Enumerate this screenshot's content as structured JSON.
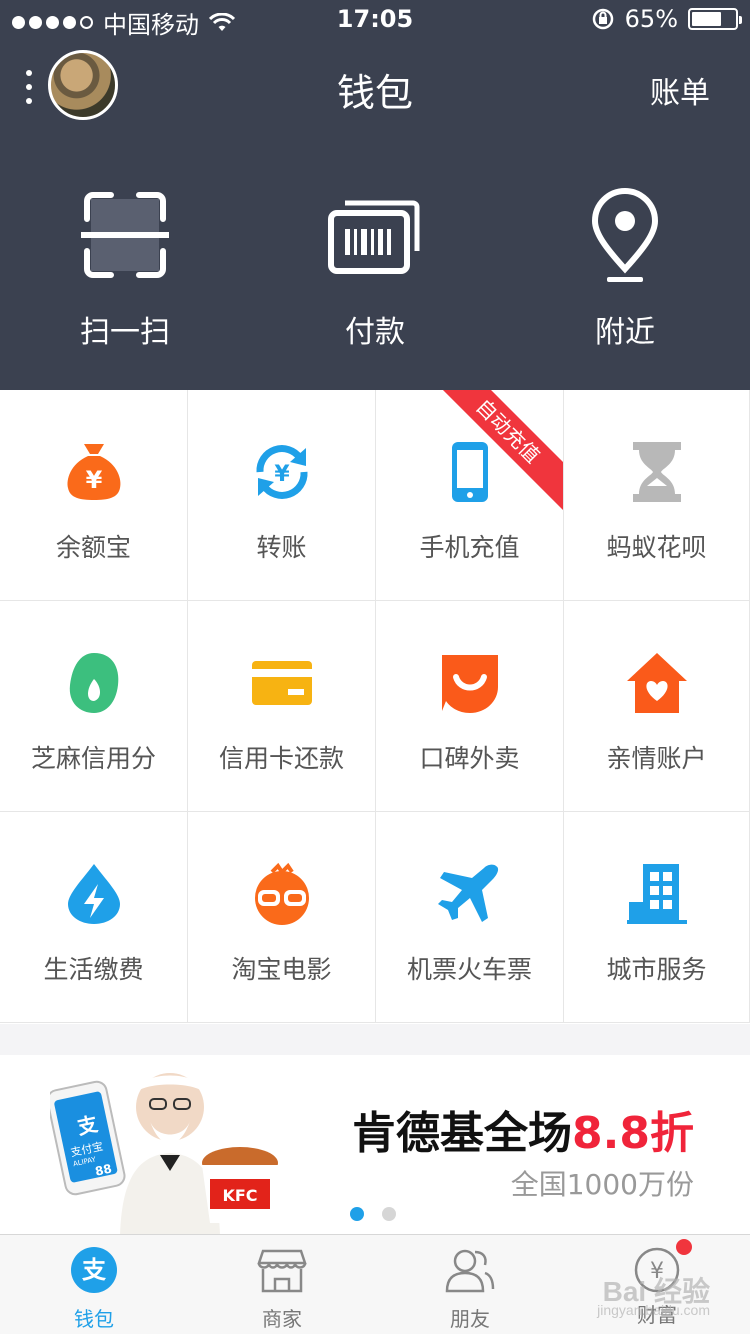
{
  "status_bar": {
    "carrier": "中国移动",
    "time": "17:05",
    "battery": "65%",
    "battery_level": 0.65,
    "icons": [
      "signal-dots-icon",
      "wifi-icon",
      "rotation-lock-icon",
      "battery-icon"
    ]
  },
  "nav": {
    "title": "钱包",
    "right_action": "账单",
    "icons": [
      "more-vertical-icon",
      "avatar"
    ]
  },
  "quick_actions": [
    {
      "label": "扫一扫",
      "icon": "scan-icon"
    },
    {
      "label": "付款",
      "icon": "barcode-pay-icon"
    },
    {
      "label": "附近",
      "icon": "location-pin-icon"
    }
  ],
  "grid": [
    {
      "label": "余额宝",
      "icon": "money-bag-icon",
      "color": "#fa6a1a"
    },
    {
      "label": "转账",
      "icon": "transfer-icon",
      "color": "#1fa0e8"
    },
    {
      "label": "手机充值",
      "icon": "phone-icon",
      "color": "#1fa0e8",
      "ribbon": "自动充值"
    },
    {
      "label": "蚂蚁花呗",
      "icon": "hourglass-icon",
      "color": "#b8b8b8"
    },
    {
      "label": "芝麻信用分",
      "icon": "sesame-icon",
      "color": "#3cbf7e"
    },
    {
      "label": "信用卡还款",
      "icon": "credit-card-icon",
      "color": "#f7b312"
    },
    {
      "label": "口碑外卖",
      "icon": "smile-icon",
      "color": "#fa5a1a"
    },
    {
      "label": "亲情账户",
      "icon": "heart-house-icon",
      "color": "#fa5a1a"
    },
    {
      "label": "生活缴费",
      "icon": "lightning-drop-icon",
      "color": "#1fa0e8"
    },
    {
      "label": "淘宝电影",
      "icon": "glasses-icon",
      "color": "#fa6a1a"
    },
    {
      "label": "机票火车票",
      "icon": "airplane-icon",
      "color": "#1fa0e8"
    },
    {
      "label": "城市服务",
      "icon": "building-icon",
      "color": "#1fa0e8"
    }
  ],
  "banner": {
    "title_prefix": "肯德基全场",
    "title_highlight": "8.8折",
    "subtitle": "全国1000万份",
    "art_text": [
      "支",
      "支付宝",
      "ALIPAY",
      "88",
      "KFC"
    ],
    "active_dot": 0,
    "dot_count": 2
  },
  "tabbar": [
    {
      "label": "钱包",
      "icon": "alipay-icon",
      "active": true
    },
    {
      "label": "商家",
      "icon": "store-icon",
      "active": false
    },
    {
      "label": "朋友",
      "icon": "friends-icon",
      "active": false
    },
    {
      "label": "财富",
      "icon": "wealth-icon",
      "active": false,
      "badge": true
    }
  ],
  "watermark": {
    "main": "Bai 经验",
    "sub": "jingyan.baidu.com"
  },
  "colors": {
    "header_bg": "#3b4150",
    "accent": "#1fa0e8",
    "highlight": "#f0243a"
  }
}
